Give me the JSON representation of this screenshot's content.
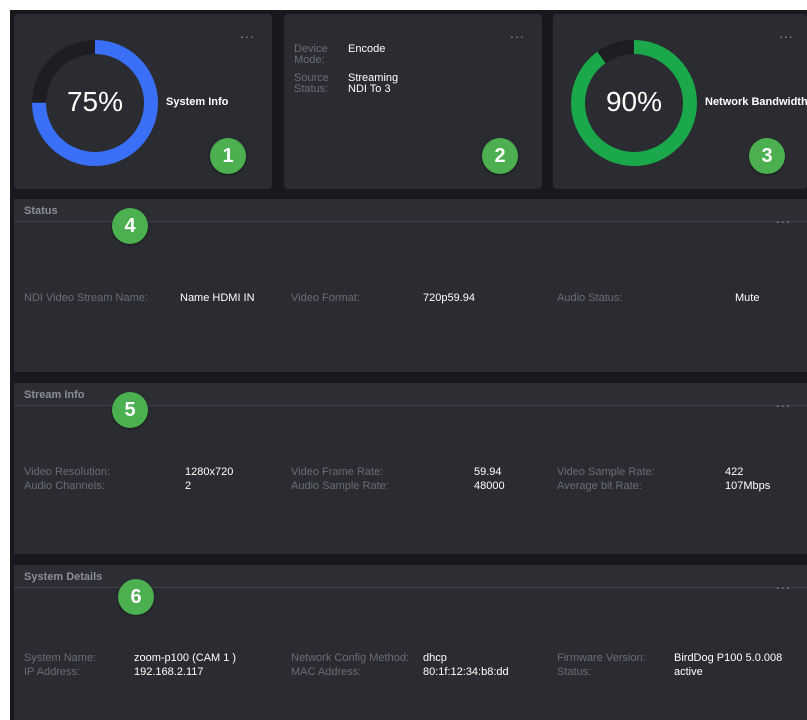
{
  "widgets": {
    "system_info": {
      "percent": 75,
      "percent_text": "75%",
      "title": "System Info",
      "badge": "1",
      "ring_color": "#3a6ff7"
    },
    "device": {
      "badge": "2",
      "rows": [
        {
          "label": "Device Mode:",
          "value": "Encode"
        },
        {
          "label": "Source Status:",
          "value": "Streaming NDI To 3"
        }
      ]
    },
    "network_bandwidth": {
      "percent": 90,
      "percent_text": "90%",
      "title": "Network Bandwidth",
      "badge": "3",
      "ring_color": "#1aa84b"
    },
    "more_icon": "..."
  },
  "status": {
    "title": "Status",
    "badge": "4",
    "fields": [
      {
        "label": "NDI Video Stream Name:",
        "value": "Name HDMI IN"
      },
      {
        "label": "Video Format:",
        "value": "720p59.94"
      },
      {
        "label": "Audio Status:",
        "value": "Mute"
      }
    ]
  },
  "stream_info": {
    "title": "Stream Info",
    "badge": "5",
    "fields": [
      {
        "label": "Video Resolution:",
        "value": "1280x720"
      },
      {
        "label": "Audio Channels:",
        "value": "2"
      },
      {
        "label": "Video Frame Rate:",
        "value": "59.94"
      },
      {
        "label": "Audio Sample Rate:",
        "value": "48000"
      },
      {
        "label": "Video Sample Rate:",
        "value": "422"
      },
      {
        "label": "Average bit Rate:",
        "value": "107Mbps"
      }
    ]
  },
  "system_details": {
    "title": "System Details",
    "badge": "6",
    "fields": [
      {
        "label": "System Name:",
        "value": "zoom-p100 (CAM 1 )"
      },
      {
        "label": "IP Address:",
        "value": "192.168.2.117"
      },
      {
        "label": "Network Config Method:",
        "value": "dhcp"
      },
      {
        "label": "MAC Address:",
        "value": "80:1f:12:34:b8:dd"
      },
      {
        "label": "Firmware Version:",
        "value": "BirdDog P100 5.0.008"
      },
      {
        "label": "Status:",
        "value": "active"
      }
    ]
  },
  "colors": {
    "badge_green": "#4caf50",
    "panel_bg": "#2a2c31",
    "page_bg": "#17191c"
  }
}
